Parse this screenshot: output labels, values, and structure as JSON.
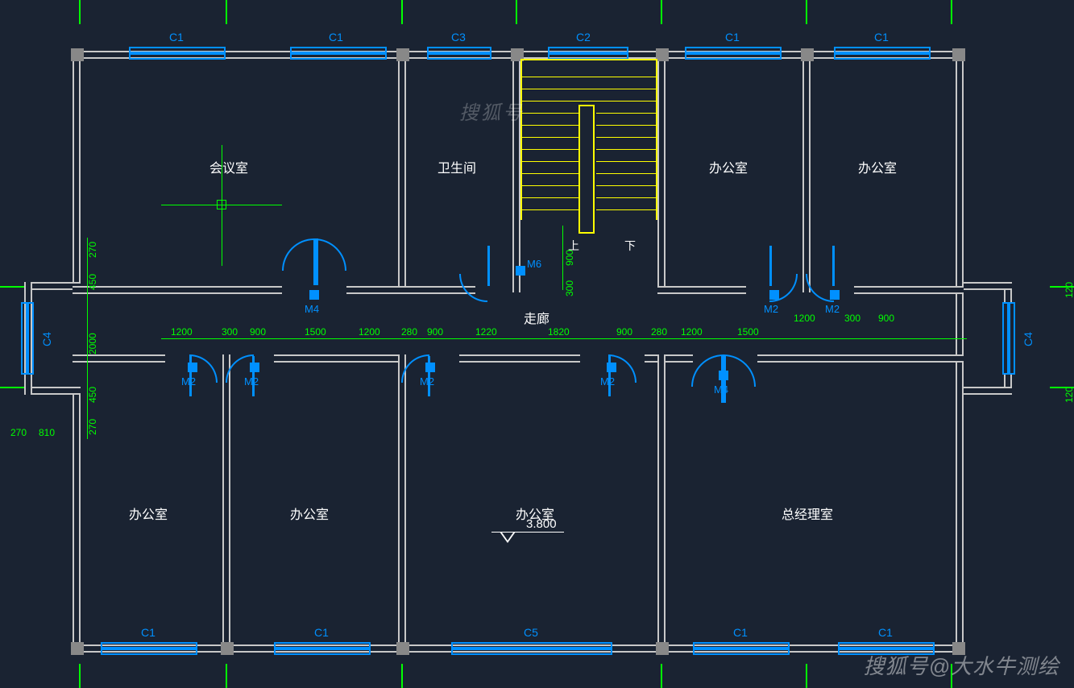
{
  "rooms": {
    "meeting": "会议室",
    "toilet": "卫生间",
    "office": "办公室",
    "corridor": "走廊",
    "gm_office": "总经理室"
  },
  "stairs": {
    "up": "上",
    "down": "下"
  },
  "windows": {
    "c1": "C1",
    "c2": "C2",
    "c3": "C3",
    "c4": "C4",
    "c5": "C5"
  },
  "doors": {
    "m2": "M2",
    "m4": "M4",
    "m6": "M6"
  },
  "dimensions": {
    "d270": "270",
    "d810": "810",
    "d450": "450",
    "d2000": "2000",
    "d1200": "1200",
    "d300": "300",
    "d900": "900",
    "d1500": "1500",
    "d280": "280",
    "d1220": "1220",
    "d1820": "1820",
    "d120": "120"
  },
  "elevation": "3.800",
  "watermark": "搜狐号@大水牛测绘",
  "watermark2": "搜狐号"
}
